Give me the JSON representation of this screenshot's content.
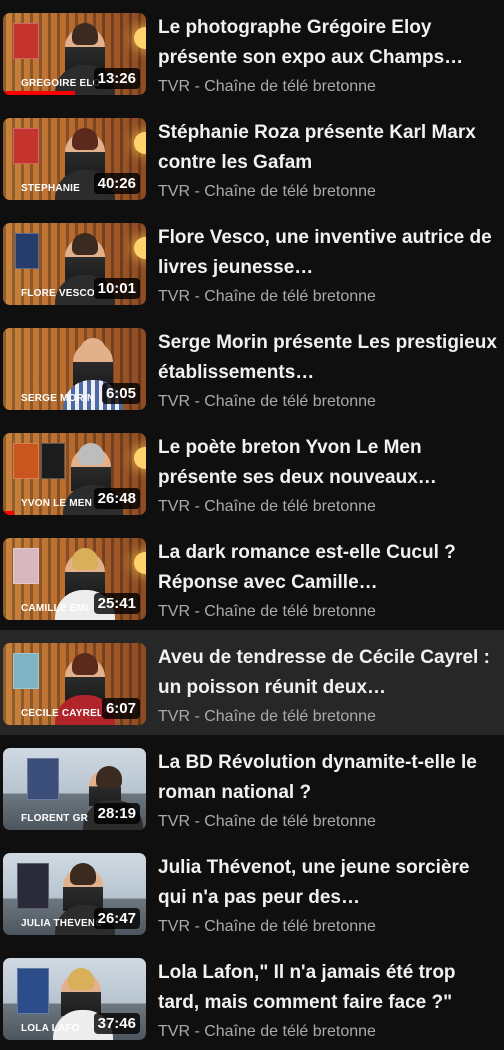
{
  "videos": [
    {
      "title": "Le photographe Grégoire Eloy présente son expo aux Champs…",
      "channel": "TVR - Chaîne de télé bretonne",
      "duration": "13:26",
      "caption": "GRÉGOIRE ELOY",
      "progress": 0.5
    },
    {
      "title": "Stéphanie Roza présente Karl Marx contre les Gafam",
      "channel": "TVR - Chaîne de télé bretonne",
      "duration": "40:26",
      "caption": "STEPHANIE",
      "progress": 0.0
    },
    {
      "title": "Flore Vesco, une inventive autrice de livres jeunesse…",
      "channel": "TVR - Chaîne de télé bretonne",
      "duration": "10:01",
      "caption": "FLORE VESCO",
      "progress": 0.0
    },
    {
      "title": "Serge Morin présente Les prestigieux établissements…",
      "channel": "TVR - Chaîne de télé bretonne",
      "duration": "6:05",
      "caption": "SERGE MORIN",
      "progress": 0.0
    },
    {
      "title": "Le poète breton Yvon Le Men présente ses deux nouveaux…",
      "channel": "TVR - Chaîne de télé bretonne",
      "duration": "26:48",
      "caption": "YVON LE MEN",
      "progress": 0.08
    },
    {
      "title": "La dark romance est-elle Cucul ? Réponse avec Camille…",
      "channel": "TVR - Chaîne de télé bretonne",
      "duration": "25:41",
      "caption": "CAMILLE EMI",
      "progress": 0.0
    },
    {
      "title": "Aveu de tendresse de Cécile Cayrel : un poisson réunit deux…",
      "channel": "TVR - Chaîne de télé bretonne",
      "duration": "6:07",
      "caption": "CÉCILE CAYREL",
      "progress": 0.0
    },
    {
      "title": "La BD Révolution dynamite-t-elle le roman national ?",
      "channel": "TVR - Chaîne de télé bretonne",
      "duration": "28:19",
      "caption": "FLORENT GR",
      "progress": 0.0
    },
    {
      "title": "Julia Thévenot, une jeune sorcière qui n'a pas peur des…",
      "channel": "TVR - Chaîne de télé bretonne",
      "duration": "26:47",
      "caption": "JULIA THÉVENOT",
      "progress": 0.0
    },
    {
      "title": "Lola Lafon,\" Il n'a jamais été trop tard, mais comment faire face ?\"",
      "channel": "TVR - Chaîne de télé bretonne",
      "duration": "37:46",
      "caption": "LOLA LAFO",
      "progress": 0.0
    }
  ]
}
